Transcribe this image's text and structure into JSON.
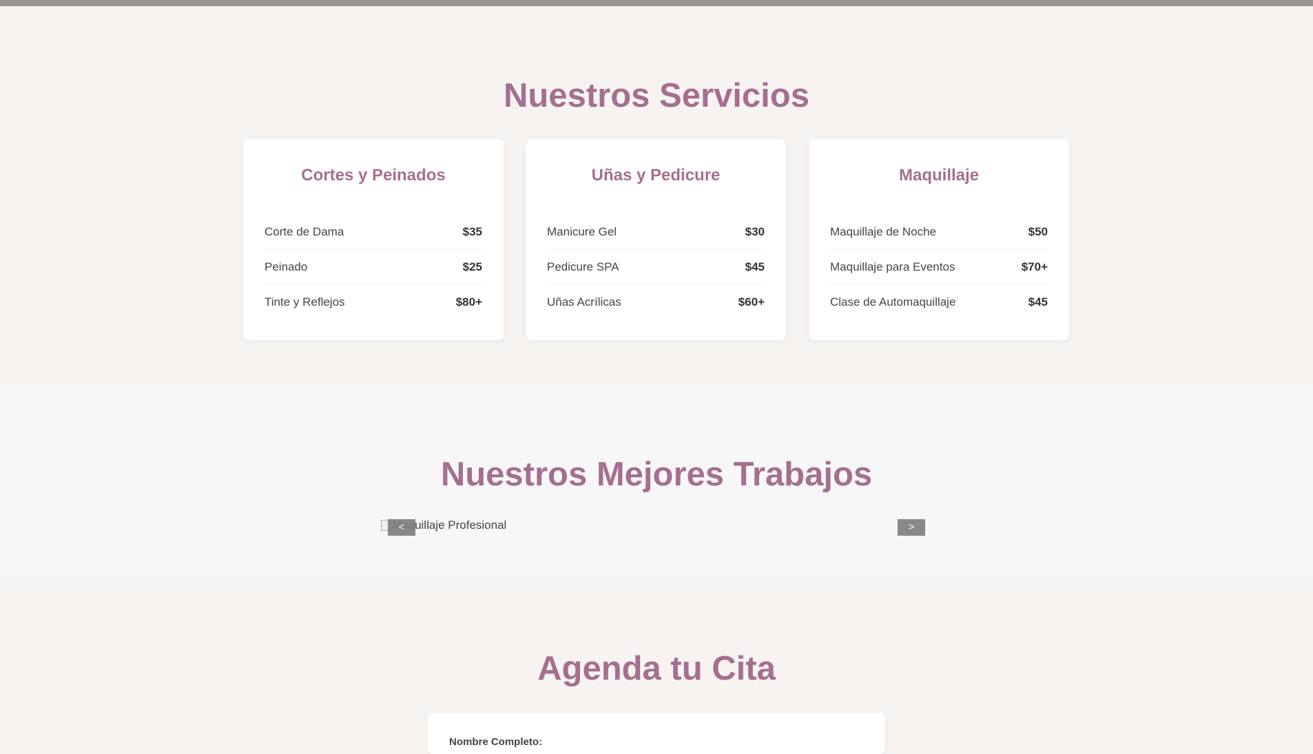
{
  "services": {
    "title": "Nuestros Servicios",
    "cards": [
      {
        "title": "Cortes y Peinados",
        "items": [
          {
            "name": "Corte de Dama",
            "price": "$35"
          },
          {
            "name": "Peinado",
            "price": "$25"
          },
          {
            "name": "Tinte y Reflejos",
            "price": "$80+"
          }
        ]
      },
      {
        "title": "Uñas y Pedicure",
        "items": [
          {
            "name": "Manicure Gel",
            "price": "$30"
          },
          {
            "name": "Pedicure SPA",
            "price": "$45"
          },
          {
            "name": "Uñas Acrílicas",
            "price": "$60+"
          }
        ]
      },
      {
        "title": "Maquillaje",
        "items": [
          {
            "name": "Maquillaje de Noche",
            "price": "$50"
          },
          {
            "name": "Maquillaje para Eventos",
            "price": "$70+"
          },
          {
            "name": "Clase de Automaquillaje",
            "price": "$45"
          }
        ]
      }
    ]
  },
  "gallery": {
    "title": "Nuestros Mejores Trabajos",
    "slide_alt": "Maquillaje Profesional",
    "prev_label": "<",
    "next_label": ">"
  },
  "booking": {
    "title": "Agenda tu Cita",
    "name_label": "Nombre Completo:"
  },
  "colors": {
    "accent": "#a56f90",
    "background": "#f7f3f1",
    "button": "#7d7d7d"
  }
}
